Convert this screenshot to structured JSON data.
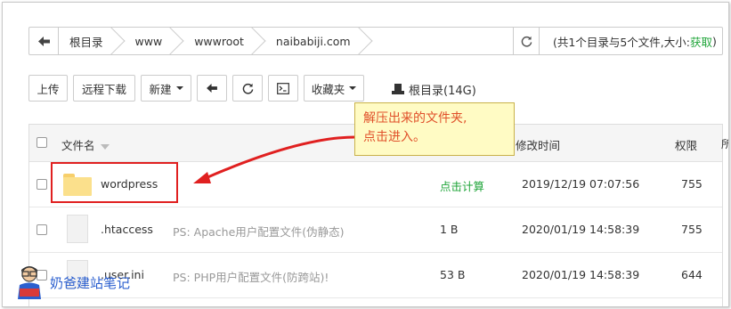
{
  "pathbar": {
    "crumbs": [
      "根目录",
      "www",
      "wwwroot",
      "naibabiji.com"
    ],
    "summary_prefix": "(共1个目录与5个文件,大小: ",
    "summary_link": "获取",
    "summary_suffix": ")"
  },
  "toolbar": {
    "upload": "上传",
    "remote_download": "远程下载",
    "new": "新建",
    "favorites": "收藏夹",
    "root_info": "根目录(14G)"
  },
  "table": {
    "headers": {
      "name": "文件名",
      "modified": "修改时间",
      "perm": "权限",
      "edge": "所"
    },
    "rows": [
      {
        "name": "wordpress",
        "note": "",
        "size": "点击计算",
        "modified": "2019/12/19 07:07:56",
        "perm": "755"
      },
      {
        "name": ".htaccess",
        "note": "PS: Apache用户配置文件(伪静态)",
        "size": "1 B",
        "modified": "2020/01/19 14:58:39",
        "perm": "755"
      },
      {
        "name": ".user.ini",
        "note": "PS: PHP用户配置文件(防跨站)!",
        "size": "53 B",
        "modified": "2020/01/19 14:58:39",
        "perm": "644"
      }
    ]
  },
  "tooltip": {
    "line1": "解压出来的文件夹,",
    "line2": "点击进入。"
  },
  "colors": {
    "accent_green": "#20a53a",
    "highlight_red": "#e02020",
    "tooltip_bg": "#fffbc4",
    "tooltip_text": "#e0502a"
  }
}
